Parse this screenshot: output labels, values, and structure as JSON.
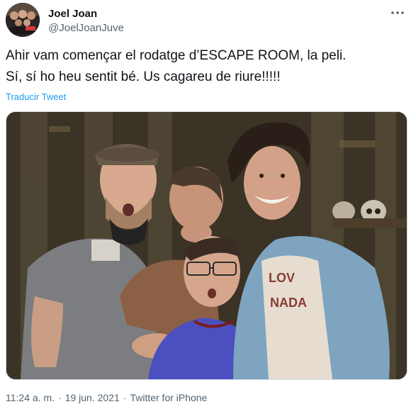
{
  "user": {
    "display_name": "Joel Joan",
    "handle": "@JoelJoanJuve"
  },
  "more_icon": "more-horizontal-icon",
  "tweet": {
    "text_line1": "Ahir vam començar el rodatge d’ESCAPE ROOM, la peli.",
    "text_line2": "Sí, sí ho heu sentit bé. Us cagareu de riure!!!!!",
    "translate_label": "Traducir Tweet"
  },
  "photo": {
    "shirt_print": "LOV\nNADA"
  },
  "meta": {
    "time": "11:24 a. m.",
    "separator": "·",
    "date": "19 jun. 2021",
    "source": "Twitter for iPhone"
  },
  "colors": {
    "text": "#0f1419",
    "secondary": "#536471",
    "link": "#1d9bf0",
    "border": "#cfd9de"
  }
}
